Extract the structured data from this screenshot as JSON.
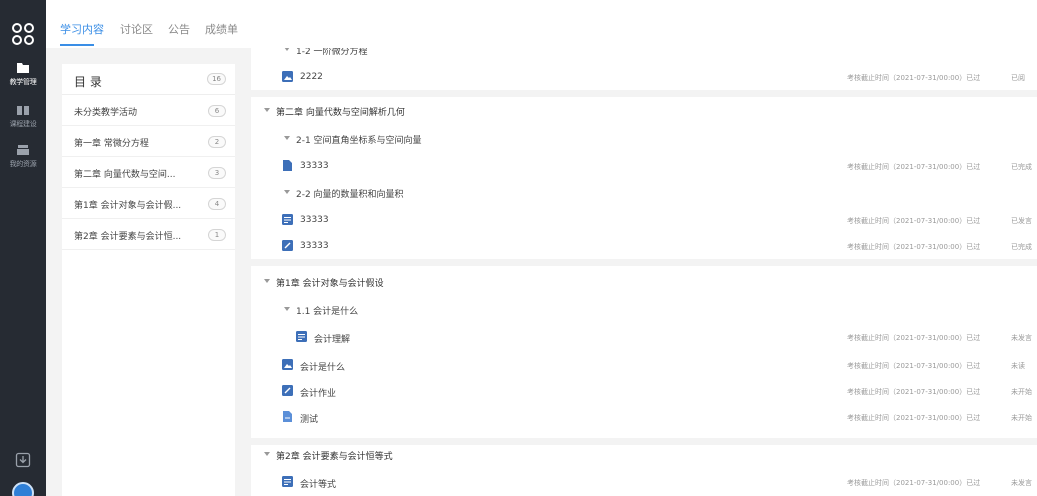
{
  "sidebar": {
    "nav": [
      {
        "label": "教学管理",
        "icon": "folder-icon",
        "active": true
      },
      {
        "label": "课程建设",
        "icon": "book-icon",
        "active": false
      },
      {
        "label": "我的资源",
        "icon": "drawer-icon",
        "active": false
      }
    ]
  },
  "tabs": [
    {
      "label": "学习内容",
      "active": true
    },
    {
      "label": "讨论区",
      "active": false
    },
    {
      "label": "公告",
      "active": false
    },
    {
      "label": "成绩单",
      "active": false
    }
  ],
  "catalog": {
    "title": "目 录",
    "count": "16",
    "items": [
      {
        "label": "未分类教学活动",
        "count": "6"
      },
      {
        "label": "第一章 常微分方程",
        "count": "2"
      },
      {
        "label": "第二章 向量代数与空间...",
        "count": "3"
      },
      {
        "label": "第1章 会计对象与会计假...",
        "count": "4"
      },
      {
        "label": "第2章 会计要素与会计恒...",
        "count": "1"
      }
    ]
  },
  "content": {
    "card0": {
      "partial_heading": "1-2 一阶微分方程",
      "rows": [
        {
          "label": "2222",
          "icon": "image-icon",
          "deadline": "考核截止时间（2021-07-31/00:00）已过",
          "status": "已阅"
        }
      ]
    },
    "card1": {
      "chapter": "第二章 向量代数与空间解析几何",
      "sec1": "2-1 空间直角坐标系与空间向量",
      "sec1_rows": [
        {
          "label": "33333",
          "icon": "doc-icon",
          "deadline": "考核截止时间（2021-07-31/00:00）已过",
          "status": "已完成"
        }
      ],
      "sec2": "2-2 向量的数量积和向量积",
      "sec2_rows": [
        {
          "label": "33333",
          "icon": "chat-icon",
          "deadline": "考核截止时间（2021-07-31/00:00）已过",
          "status": "已发言"
        },
        {
          "label": "33333",
          "icon": "edit-icon",
          "deadline": "考核截止时间（2021-07-31/00:00）已过",
          "status": "已完成"
        }
      ]
    },
    "card2": {
      "chapter": "第1章 会计对象与会计假设",
      "sec1": "1.1 会计是什么",
      "sec1_rows": [
        {
          "label": "会计理解",
          "icon": "chat-icon",
          "deadline": "考核截止时间（2021-07-31/00:00）已过",
          "status": "未发言"
        }
      ],
      "rows": [
        {
          "label": "会计是什么",
          "icon": "image-icon",
          "deadline": "考核截止时间（2021-07-31/00:00）已过",
          "status": "未读"
        },
        {
          "label": "会计作业",
          "icon": "edit-icon",
          "deadline": "考核截止时间（2021-07-31/00:00）已过",
          "status": "未开始"
        },
        {
          "label": "测试",
          "icon": "test-icon",
          "deadline": "考核截止时间（2021-07-31/00:00）已过",
          "status": "未开始"
        }
      ]
    },
    "card3": {
      "chapter": "第2章 会计要素与会计恒等式",
      "rows": [
        {
          "label": "会计等式",
          "icon": "chat-icon",
          "deadline": "考核截止时间（2021-07-31/00:00）已过",
          "status": "未发言"
        }
      ]
    }
  },
  "colors": {
    "accent": "#3a8ee6",
    "rail": "#262b33",
    "icon": "#3d6fb8"
  }
}
